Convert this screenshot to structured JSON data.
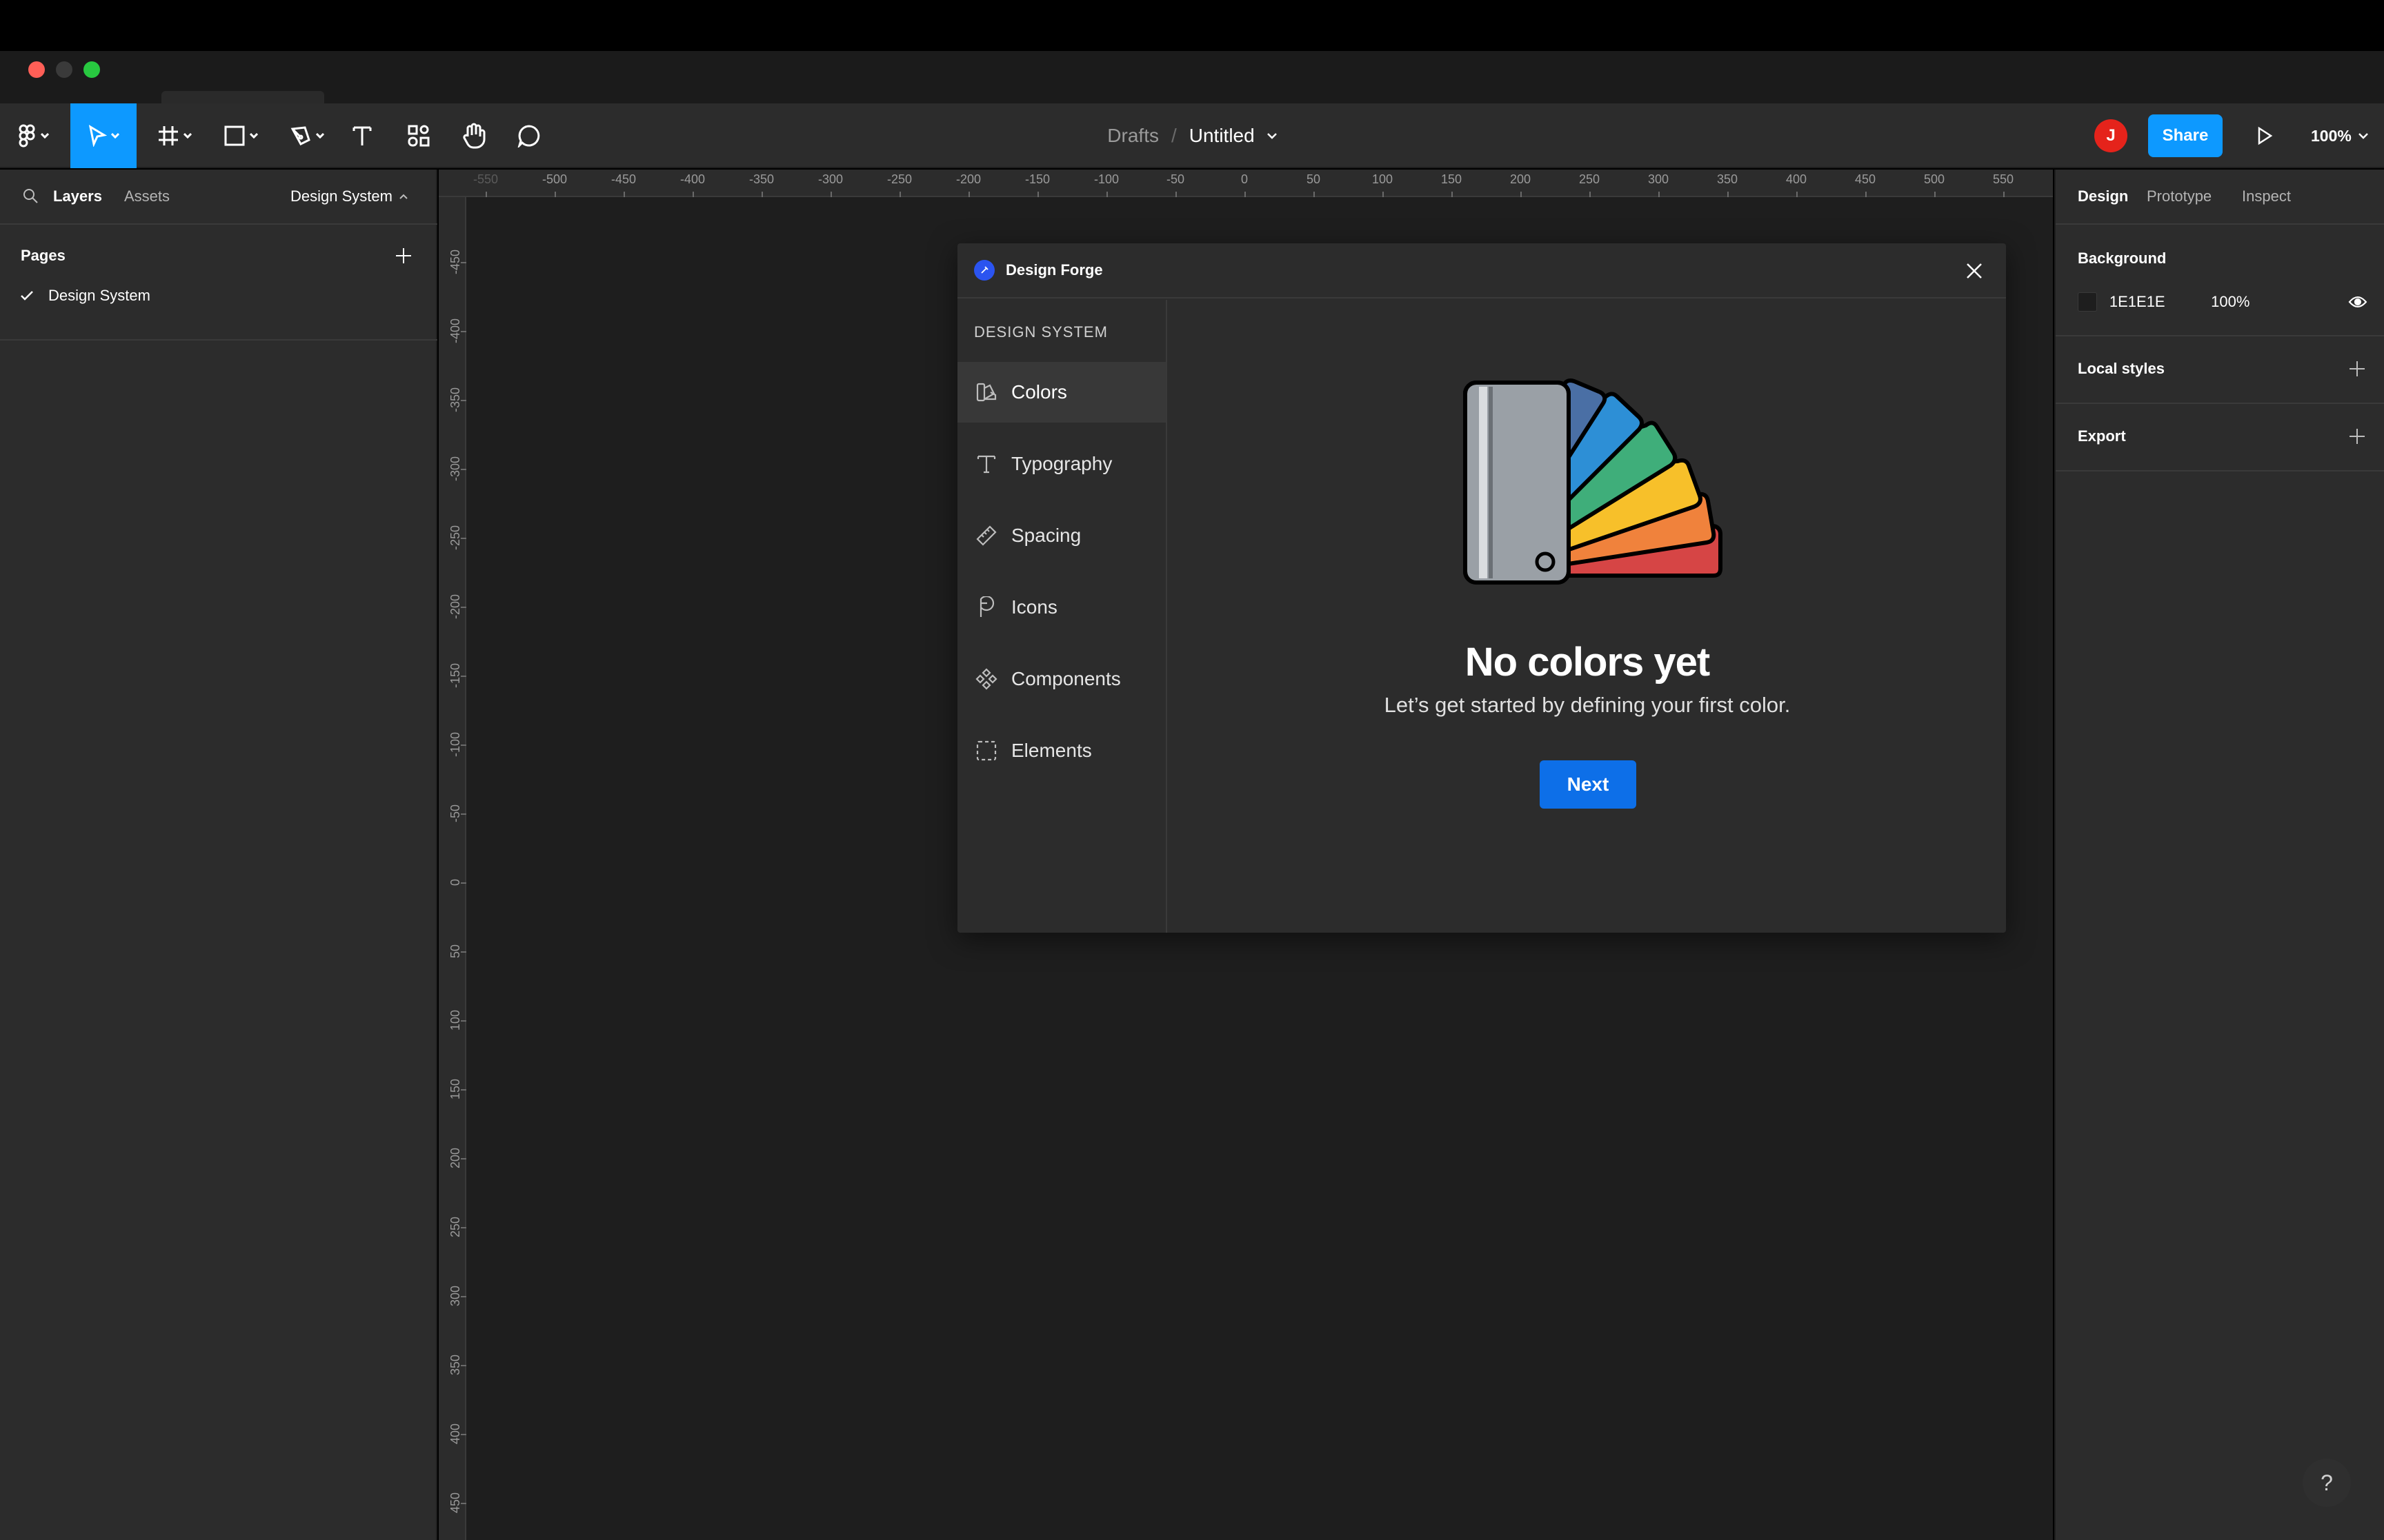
{
  "window": {
    "traffic_lights": [
      "close",
      "minimize",
      "zoom"
    ]
  },
  "toolbar": {
    "tools": [
      {
        "name": "main-menu",
        "icon": "figma-logo-icon"
      },
      {
        "name": "move",
        "icon": "cursor-arrow-icon",
        "active": true
      },
      {
        "name": "frame",
        "icon": "frame-hash-icon"
      },
      {
        "name": "shape",
        "icon": "rectangle-icon"
      },
      {
        "name": "pen",
        "icon": "pen-icon"
      },
      {
        "name": "text",
        "icon": "text-icon"
      },
      {
        "name": "resources",
        "icon": "resources-icon"
      },
      {
        "name": "hand",
        "icon": "hand-icon"
      },
      {
        "name": "comment",
        "icon": "comment-icon"
      }
    ],
    "breadcrumb_parent": "Drafts",
    "breadcrumb_separator": "/",
    "file_name": "Untitled",
    "avatar_initial": "J",
    "share_label": "Share",
    "zoom_label": "100%",
    "accent_color": "#0d99ff",
    "avatar_color": "#e5231b"
  },
  "left_panel": {
    "tabs": {
      "layers": "Layers",
      "assets": "Assets"
    },
    "page_selector": "Design System",
    "pages_title": "Pages",
    "pages": [
      {
        "label": "Design System",
        "selected": true
      }
    ]
  },
  "canvas": {
    "background": "#1e1e1e",
    "ruler_h": [
      "-550",
      "-500",
      "-450",
      "-400",
      "-350",
      "-300",
      "-250",
      "-200",
      "-150",
      "-100",
      "-50",
      "0",
      "50",
      "100",
      "150",
      "200",
      "250",
      "300",
      "350",
      "400",
      "450",
      "500",
      "550"
    ],
    "ruler_v": [
      "-450",
      "-400",
      "-350",
      "-300",
      "-250",
      "-200",
      "-150",
      "-100",
      "-50",
      "0",
      "50",
      "100",
      "150",
      "200",
      "250",
      "300",
      "350",
      "400",
      "450",
      "0"
    ]
  },
  "dialog": {
    "title": "Design Forge",
    "section_label": "DESIGN SYSTEM",
    "nav": [
      {
        "label": "Colors",
        "icon": "swatch-icon",
        "active": true
      },
      {
        "label": "Typography",
        "icon": "type-icon"
      },
      {
        "label": "Spacing",
        "icon": "ruler-icon"
      },
      {
        "label": "Icons",
        "icon": "leaf-icon"
      },
      {
        "label": "Components",
        "icon": "component-icon"
      },
      {
        "label": "Elements",
        "icon": "dashed-square-icon"
      }
    ],
    "empty_title": "No colors yet",
    "empty_subtitle": "Let’s get started by defining your first color.",
    "next_label": "Next",
    "swatch_colors": [
      "#d64545",
      "#f0823c",
      "#f7c02a",
      "#3fae7a",
      "#2d8fd6",
      "#4a6fa5",
      "#9aa0a6"
    ]
  },
  "right_panel": {
    "tabs": {
      "design": "Design",
      "prototype": "Prototype",
      "inspect": "Inspect"
    },
    "background_title": "Background",
    "background_hex": "1E1E1E",
    "background_opacity": "100%",
    "local_styles_title": "Local styles",
    "export_title": "Export"
  },
  "help_label": "?"
}
